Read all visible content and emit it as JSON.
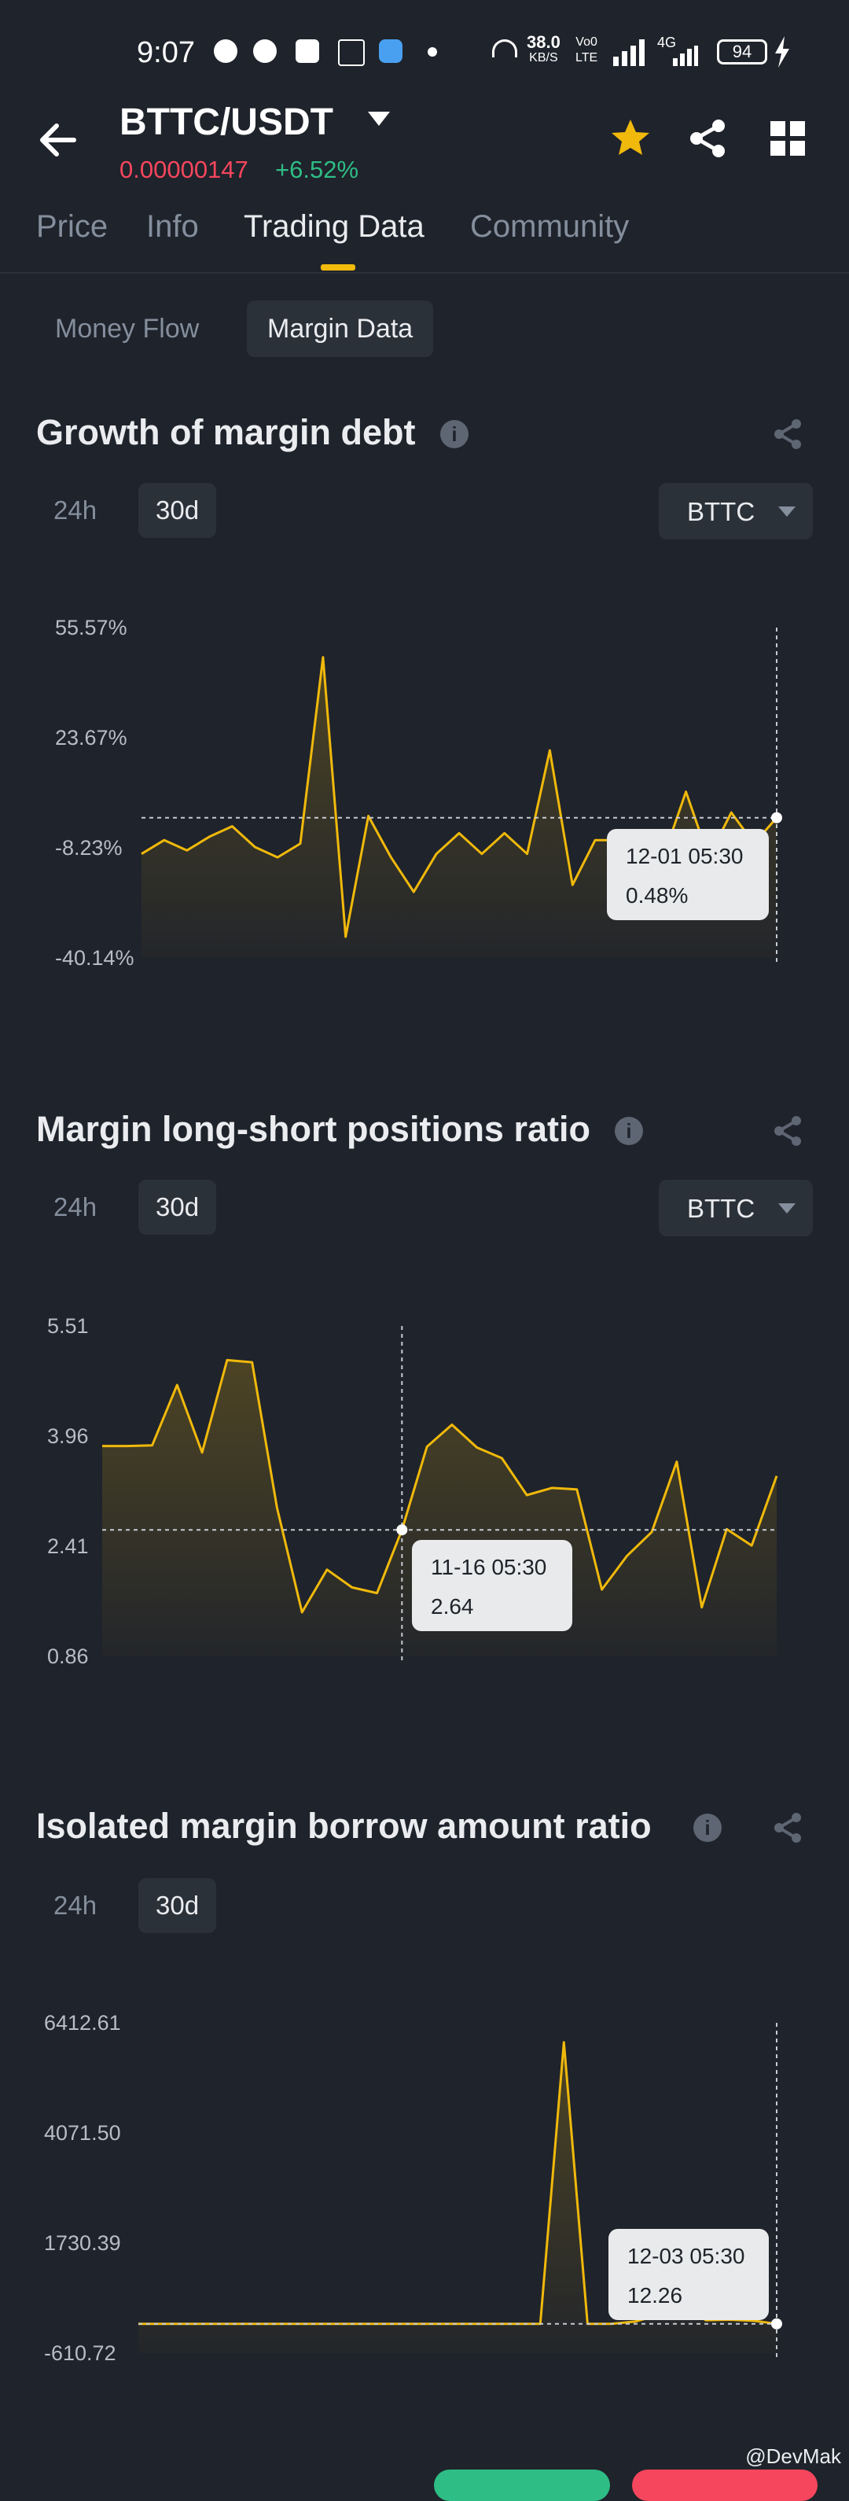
{
  "status_bar": {
    "time": "9:07",
    "net_speed_top": "38.0",
    "net_speed_bottom": "KB/S",
    "volte_top": "Vo0",
    "volte_bottom": "LTE",
    "network": "4G",
    "battery": "94"
  },
  "header": {
    "pair": "BTTC/USDT",
    "price": "0.00000147",
    "change": "+6.52%",
    "colors": {
      "price": "#f6465d",
      "change": "#2ebd85",
      "star": "#f0b90b"
    },
    "icons": [
      "back-arrow-icon",
      "star-icon",
      "share-icon",
      "grid-icon"
    ]
  },
  "tabs": [
    "Price",
    "Info",
    "Trading Data",
    "Community"
  ],
  "active_tab": "Trading Data",
  "sub_tabs": [
    "Money Flow",
    "Margin Data"
  ],
  "active_sub_tab": "Margin Data",
  "sections": [
    {
      "title": "Growth of margin debt",
      "periods": [
        "24h",
        "30d"
      ],
      "active_period": "30d",
      "coin": "BTTC",
      "tooltip": {
        "date": "12-01 05:30",
        "value": "0.48%"
      }
    },
    {
      "title": "Margin long-short positions ratio",
      "periods": [
        "24h",
        "30d"
      ],
      "active_period": "30d",
      "coin": "BTTC",
      "tooltip": {
        "date": "11-16 05:30",
        "value": "2.64"
      }
    },
    {
      "title": "Isolated margin borrow amount ratio",
      "periods": [
        "24h",
        "30d"
      ],
      "active_period": "30d",
      "tooltip": {
        "date": "12-03 05:30",
        "value": "12.26"
      }
    }
  ],
  "chart_data": [
    {
      "type": "area",
      "title": "Growth of margin debt",
      "y_ticks": [
        "55.57%",
        "23.67%",
        "-8.23%",
        "-40.14%"
      ],
      "ylim": [
        -40.14,
        55.57
      ],
      "values": [
        -10,
        -6,
        -9,
        -5,
        -2,
        -8,
        -11,
        -7,
        47,
        -34,
        1,
        -11,
        -21,
        -10,
        -4,
        -10,
        -4,
        -10,
        20,
        -19,
        -6,
        -6,
        -8,
        -11,
        8,
        -11,
        2,
        -7,
        0.48
      ],
      "crosshair_index": 28,
      "line_color": "#f0b90b"
    },
    {
      "type": "area",
      "title": "Margin long-short positions ratio",
      "y_ticks": [
        "5.51",
        "3.96",
        "2.41",
        "0.86"
      ],
      "ylim": [
        0.86,
        5.51
      ],
      "values": [
        3.82,
        3.82,
        3.83,
        4.68,
        3.73,
        5.03,
        5.0,
        2.95,
        1.48,
        2.08,
        1.83,
        1.75,
        2.64,
        3.81,
        4.12,
        3.8,
        3.65,
        3.13,
        3.23,
        3.21,
        1.8,
        2.27,
        2.61,
        3.6,
        1.55,
        2.65,
        2.42,
        3.4
      ],
      "crosshair_index": 12,
      "line_color": "#f0b90b"
    },
    {
      "type": "area",
      "title": "Isolated margin borrow amount ratio",
      "y_ticks": [
        "6412.61",
        "4071.50",
        "1730.39",
        "-610.72"
      ],
      "ylim": [
        -610.72,
        6412.61
      ],
      "values": [
        12,
        12,
        12,
        12,
        12,
        12,
        12,
        12,
        12,
        12,
        12,
        12,
        12,
        12,
        12,
        12,
        12,
        12,
        6000,
        12,
        12,
        60,
        200,
        500,
        90,
        100,
        80,
        12.26
      ],
      "crosshair_index": 27,
      "line_color": "#f0b90b"
    }
  ],
  "watermark": "@DevMak"
}
